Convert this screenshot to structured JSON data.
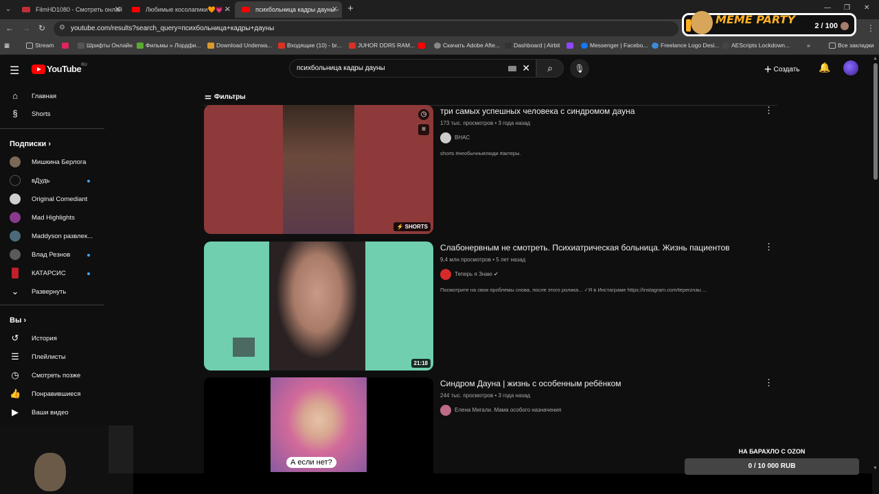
{
  "browser": {
    "tabs": [
      {
        "label": "FilmHD1080 - Смотреть онлай",
        "active": false,
        "favicon_color": "#c0303a"
      },
      {
        "label": "Любимые косолапики🧡💗 -",
        "active": false,
        "favicon_color": "#ff0000"
      },
      {
        "label": "психбольница кадры дауны -",
        "active": true,
        "favicon_color": "#ff0000"
      }
    ],
    "url": "youtube.com/results?search_query=психбольница+кадры+дауны",
    "bookmarks": [
      {
        "label": "Stream",
        "color": "#8a8a8a"
      },
      {
        "label": "",
        "color": "#e0245e"
      },
      {
        "label": "Шрифты Онлайн",
        "color": "#555555"
      },
      {
        "label": "Фильмы » Лордфи...",
        "color": "#5aa832"
      },
      {
        "label": "Download Underwa...",
        "color": "#d89a2b"
      },
      {
        "label": "Входящие (10) - br...",
        "color": "#d93025"
      },
      {
        "label": "JUHOR DDR5 RAM...",
        "color": "#d93025"
      },
      {
        "label": "",
        "color": "#ff0000"
      },
      {
        "label": "Скачать Adobe Afte...",
        "color": "#888888"
      },
      {
        "label": "Dashboard | Airbit",
        "color": "#333333"
      },
      {
        "label": "",
        "color": "#9146ff"
      },
      {
        "label": "Messenger | Facebo...",
        "color": "#1877f2"
      },
      {
        "label": "Freelance Logo Desi...",
        "color": "#3c8bd9"
      },
      {
        "label": "AEScripts Lockdown...",
        "color": "#444444"
      }
    ],
    "all_bookmarks": "Все закладки"
  },
  "meme_party": {
    "title": "MEME PARTY",
    "count": "2 / 100"
  },
  "header": {
    "logo": "YouTube",
    "region": "RU",
    "search_query": "психбольница кадры дауны",
    "create_label": "Создать"
  },
  "sidebar": {
    "main": [
      {
        "label": "Главная",
        "icon": "home-icon",
        "glyph": "⌂"
      },
      {
        "label": "Shorts",
        "icon": "shorts-icon",
        "glyph": "§"
      }
    ],
    "subs_heading": "Подписки",
    "subscriptions": [
      {
        "label": "Мишкина Берлога",
        "color": "#7a6a55",
        "dot": false
      },
      {
        "label": "вДудь",
        "color": "#111111",
        "dot": true
      },
      {
        "label": "Original Comediant",
        "color": "#d0d0d0",
        "dot": false
      },
      {
        "label": "Mad Highlights",
        "color": "#8a3a8c",
        "dot": false
      },
      {
        "label": "Maddyson развлек...",
        "color": "#4a6a7a",
        "dot": false
      },
      {
        "label": "Влад Резнов",
        "color": "#5a5a5a",
        "dot": true
      },
      {
        "label": "КАТАРСИС",
        "color": "#c0202a",
        "dot": true
      }
    ],
    "expand_label": "Развернуть",
    "you_heading": "Вы",
    "you_items": [
      {
        "label": "История",
        "icon": "history-icon",
        "glyph": "↺"
      },
      {
        "label": "Плейлисты",
        "icon": "playlists-icon",
        "glyph": "☰"
      },
      {
        "label": "Смотреть позже",
        "icon": "watch-later-icon",
        "glyph": "◷"
      },
      {
        "label": "Понравившиеся",
        "icon": "liked-icon",
        "glyph": "👍"
      },
      {
        "label": "Ваши видео",
        "icon": "your-videos-icon",
        "glyph": "▶"
      }
    ]
  },
  "filters_label": "Фильтры",
  "results": [
    {
      "title": "три самых успешных человека с синдромом дауна",
      "meta": "173 тыс. просмотров • 3 года назад",
      "channel": "ВНАС",
      "verified": false,
      "description": "shorts #необычныелюди #актеры.",
      "badge": "SHORTS",
      "thumb_bg": "#8e3a3a",
      "thumb_center": "#6b4a3c",
      "channel_color": "#cccccc"
    },
    {
      "title": "Слабонервным не смотреть. Психиатрическая больница. Жизнь пациентов",
      "meta": "9,4 млн просмотров • 5 лет назад",
      "channel": "Теперь я Знаю",
      "verified": true,
      "description": "Посмотрите на свои проблемы снова, после этого ролика... ✓Я в Инстаграме https://instagram.com/teperznau ...",
      "badge": "21:18",
      "thumb_bg": "#6fcfae",
      "thumb_center": "#4a3a34",
      "channel_color": "#d62a2a"
    },
    {
      "title": "Синдром Дауна | жизнь с особенным ребёнком",
      "meta": "244 тыс. просмотров • 3 года назад",
      "channel": "Елена Мигали. Мама особого назначения",
      "verified": false,
      "description": "",
      "badge": "",
      "caption": "А если нет?",
      "thumb_bg": "#000000",
      "thumb_center": "#d26a9a",
      "channel_color": "#c06a8a"
    }
  ],
  "donation": {
    "label": "НА БАРАХЛО С OZON",
    "value": "0 / 10 000 RUB"
  }
}
